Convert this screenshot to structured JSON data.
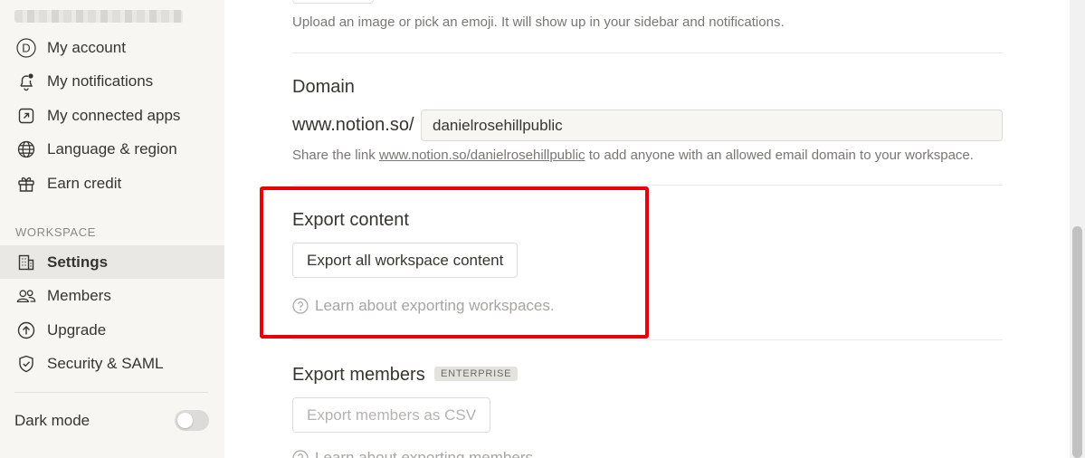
{
  "sidebar": {
    "account_items": [
      {
        "label": "My account",
        "icon": "user-avatar-icon",
        "avatar_letter": "D"
      },
      {
        "label": "My notifications",
        "icon": "bell-icon"
      },
      {
        "label": "My connected apps",
        "icon": "external-link-icon"
      },
      {
        "label": "Language & region",
        "icon": "globe-icon"
      },
      {
        "label": "Earn credit",
        "icon": "gift-icon"
      }
    ],
    "workspace_label": "WORKSPACE",
    "workspace_items": [
      {
        "label": "Settings",
        "icon": "building-icon",
        "active": true
      },
      {
        "label": "Members",
        "icon": "people-icon"
      },
      {
        "label": "Upgrade",
        "icon": "upgrade-arrow-icon"
      },
      {
        "label": "Security & SAML",
        "icon": "shield-check-icon"
      }
    ],
    "dark_mode_label": "Dark mode",
    "dark_mode_on": false
  },
  "main": {
    "icon_hint": "Upload an image or pick an emoji. It will show up in your sidebar and notifications.",
    "domain": {
      "title": "Domain",
      "prefix": "www.notion.so/",
      "value": "danielrosehillpublic",
      "share_before": "Share the link ",
      "share_link": "www.notion.so/danielrosehillpublic",
      "share_after": " to add anyone with an allowed email domain to your workspace."
    },
    "export_content": {
      "title": "Export content",
      "button": "Export all workspace content",
      "learn": "Learn about exporting workspaces."
    },
    "export_members": {
      "title": "Export members",
      "badge": "ENTERPRISE",
      "button": "Export members as CSV",
      "learn": "Learn about exporting members."
    }
  },
  "colors": {
    "highlight": "#e8000b",
    "sidebar_bg": "#f7f6f3",
    "text": "#37352f",
    "muted": "#787774"
  }
}
